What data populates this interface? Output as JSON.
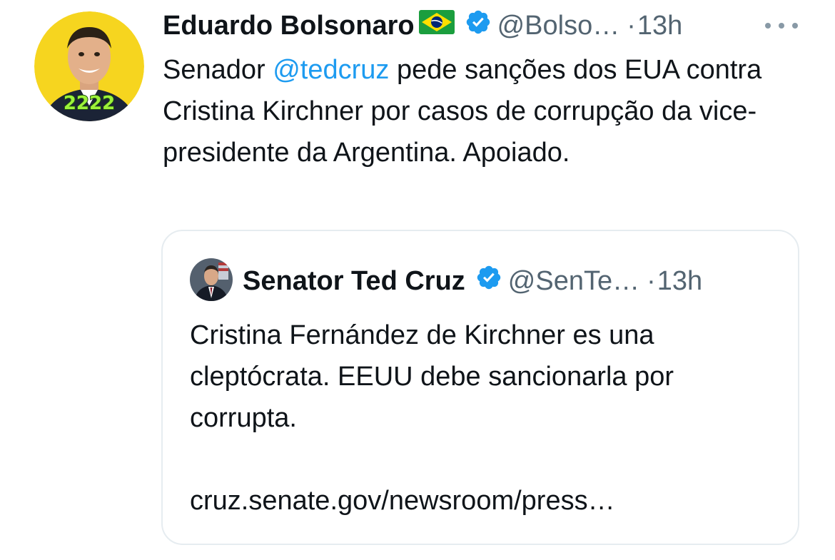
{
  "tweet": {
    "author_name": "Eduardo Bolsonaro",
    "flag_icon": "brazil-flag-icon",
    "handle": "@Bolso…",
    "separator": "·",
    "time": "13h",
    "avatar_badge": "2222",
    "text_before": "Senador ",
    "mention": "@tedcruz",
    "text_after": " pede sanções dos EUA contra Cristina Kirchner por casos de corrupção da vice-presidente da Argentina. Apoiado."
  },
  "quote": {
    "author_name": "Senator Ted Cruz",
    "handle": "@SenTe…",
    "separator": "·",
    "time": "13h",
    "text": "Cristina Fernández de Kirchner es una cleptócrata. EEUU debe sancionarla por corrupta.",
    "link": "cruz.senate.gov/newsroom/press…"
  },
  "colors": {
    "accent": "#1d9bf0",
    "text": "#0f1419",
    "muted": "#536471",
    "border": "#e6ecf0"
  }
}
